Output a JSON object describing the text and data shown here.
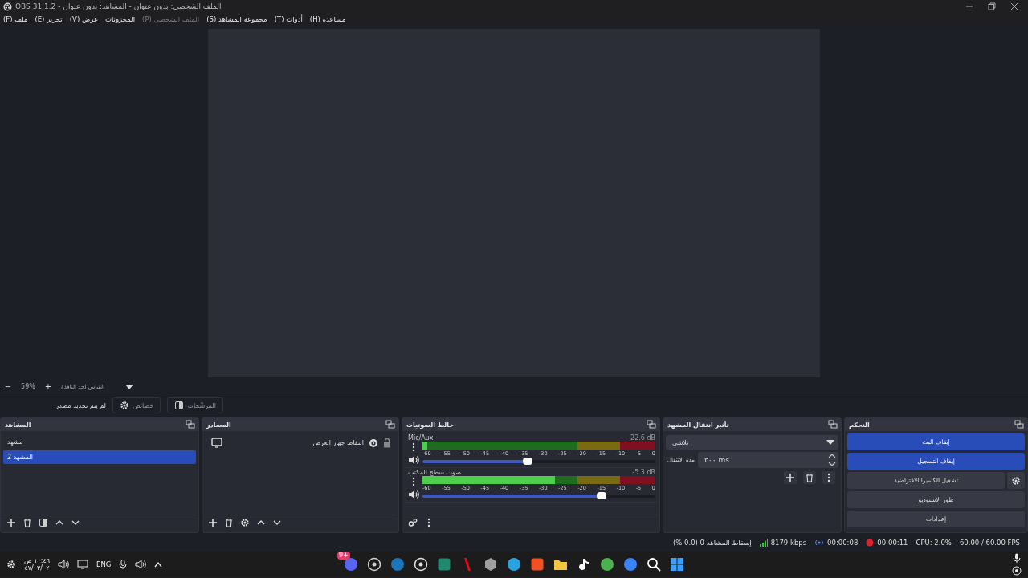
{
  "window": {
    "title": "الملف الشخصي: بدون عنوان - المشاهد: بدون عنوان - OBS 31.1.2"
  },
  "menu": [
    {
      "label": "مساعدة (H)",
      "disabled": false
    },
    {
      "label": "أدوات (T)",
      "disabled": false
    },
    {
      "label": "مجموعة المشاهد (S)",
      "disabled": false
    },
    {
      "label": "الملف الشخصي (P)",
      "disabled": true
    },
    {
      "label": "المخزونات",
      "disabled": false
    },
    {
      "label": "عرض (V)",
      "disabled": false
    },
    {
      "label": "تحرير (E)",
      "disabled": false
    },
    {
      "label": "ملف (F)",
      "disabled": false
    }
  ],
  "zoom_bar": {
    "zoom_out": "−",
    "zoom": "59%",
    "zoom_in": "+",
    "scale_mode": "القياس لحد النافذة"
  },
  "context_bar": {
    "status": "لم يتم تحديد مصدر",
    "buttons": [
      {
        "label": "المرشّحات",
        "kind": "filters"
      },
      {
        "label": "خصائص",
        "kind": "properties"
      }
    ]
  },
  "scenes": {
    "title": "المشاهد",
    "items": [
      {
        "label": "مشهد",
        "selected": false
      },
      {
        "label": "المشهد 2",
        "selected": true
      }
    ]
  },
  "sources": {
    "title": "المصادر",
    "items": [
      {
        "label": "التقاط جهاز العرض",
        "kind": "display",
        "visible": true,
        "locked": true
      }
    ]
  },
  "mixer": {
    "title": "خالط الصوتيات",
    "channels": [
      {
        "name": "Mic/Aux",
        "reading": "-22.6 dB",
        "muted": false,
        "meter": {
          "level": 0.02
        },
        "fader": {
          "level": 0.45
        },
        "scale": [
          "0",
          "-5",
          "-10",
          "-15",
          "-20",
          "-25",
          "-30",
          "-35",
          "-40",
          "-45",
          "-50",
          "-55",
          "-60"
        ]
      },
      {
        "name": "صوت سطح المكتب",
        "reading": "-5.3 dB",
        "muted": false,
        "meter": {
          "level": 0.57
        },
        "fader": {
          "level": 0.77
        },
        "scale": [
          "0",
          "-5",
          "-10",
          "-15",
          "-20",
          "-25",
          "-30",
          "-35",
          "-40",
          "-45",
          "-50",
          "-55",
          "-60"
        ]
      }
    ]
  },
  "transitions": {
    "title": "تأثير انتقال المشهد",
    "transition": "تلاشي",
    "duration_label": "مدة الانتقال",
    "duration": "٣٠٠ ms"
  },
  "controls": {
    "title": "التحكم",
    "buttons": [
      {
        "label": "إيقاف البث",
        "active": true,
        "kind": "plain"
      },
      {
        "label": "إيقاف التسجيل",
        "active": true,
        "kind": "plain"
      },
      {
        "label": "تشغيل الكاميرا الافتراضية",
        "active": false,
        "kind": "with-settings"
      },
      {
        "label": "طور الاستوديو",
        "active": false,
        "kind": "plain"
      },
      {
        "label": "إعدادات",
        "active": false,
        "kind": "plain"
      }
    ]
  },
  "status_bar": {
    "dropped_frames": "إسقاط المشاهد 0 (0.0 %)",
    "bitrate": "8179 kbps",
    "stream_time": "00:00:08",
    "record_time": "00:00:11",
    "cpu": "CPU: 2.0%",
    "fps": "60.00 / 60.00 FPS"
  },
  "taskbar": {
    "time": "١٠:٤٦ ص",
    "date": "٤٧/٠٣/٠٢",
    "language": "ENG",
    "apps": [
      {
        "kind": "circle",
        "color": "#5865f2",
        "badge": "9+"
      },
      {
        "kind": "ring",
        "color": "#d0d0d0"
      },
      {
        "kind": "circle",
        "color": "#1b75b8"
      },
      {
        "kind": "ring",
        "color": "#e0e0e0"
      },
      {
        "kind": "square",
        "color": "#1f8a6e"
      },
      {
        "kind": "letter-bar",
        "color": "#e50914"
      },
      {
        "kind": "hexagon",
        "color": "#a0a0a0"
      },
      {
        "kind": "circle",
        "color": "#2aa3e0"
      },
      {
        "kind": "square",
        "color": "#f25022"
      },
      {
        "kind": "folder",
        "color": "#f5c542"
      },
      {
        "kind": "note",
        "color": "#ffffff"
      },
      {
        "kind": "circle",
        "color": "#4caf50"
      },
      {
        "kind": "circle",
        "color": "#3b82f6"
      },
      {
        "kind": "search",
        "color": "#ffffff"
      },
      {
        "kind": "grid",
        "color": "#3aa0ff"
      }
    ]
  }
}
